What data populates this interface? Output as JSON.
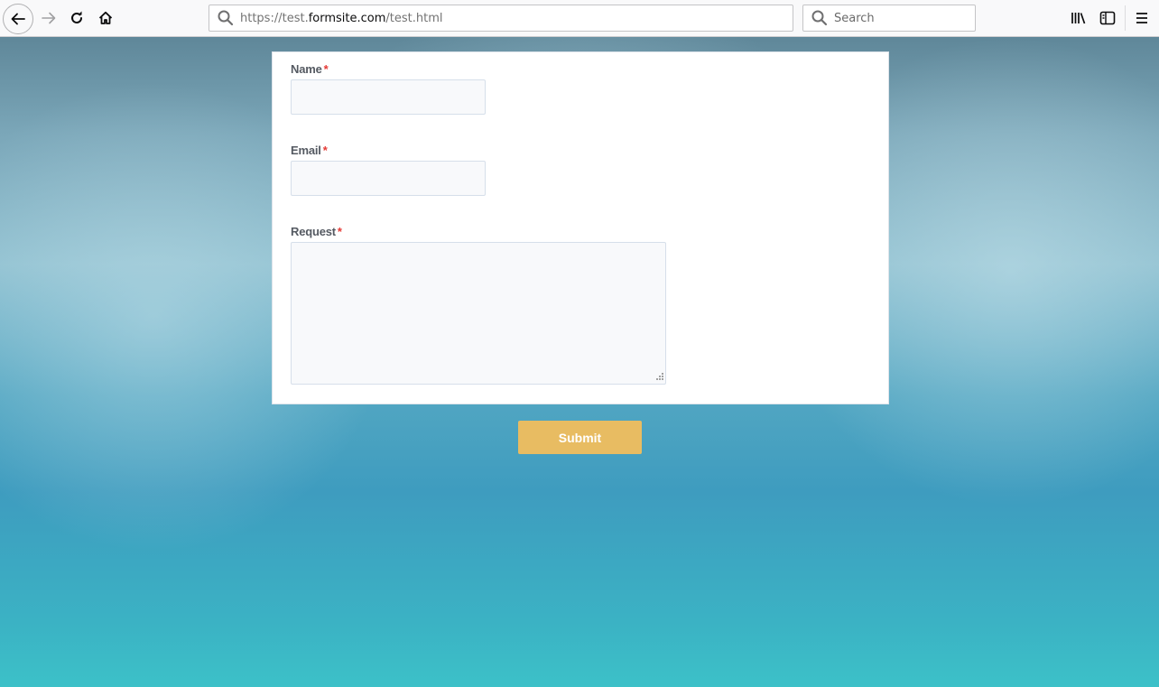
{
  "browser": {
    "url_prefix": "https://test.",
    "url_host": "formsite.com",
    "url_path": "/test.html",
    "search_placeholder": "Search",
    "icons": [
      "back-arrow-icon",
      "forward-arrow-icon",
      "reload-icon",
      "home-icon",
      "search-icon",
      "library-icon",
      "sidebar-icon",
      "hamburger-menu-icon"
    ]
  },
  "form": {
    "fields": [
      {
        "label": "Name",
        "required_marker": "*",
        "value": ""
      },
      {
        "label": "Email",
        "required_marker": "*",
        "value": ""
      },
      {
        "label": "Request",
        "required_marker": "*",
        "value": ""
      }
    ],
    "submit_label": "Submit"
  },
  "colors": {
    "submit_bg": "#e8bc62",
    "required_marker": "#e53935",
    "label_text": "#555a62",
    "input_bg": "#f8f9fb"
  }
}
